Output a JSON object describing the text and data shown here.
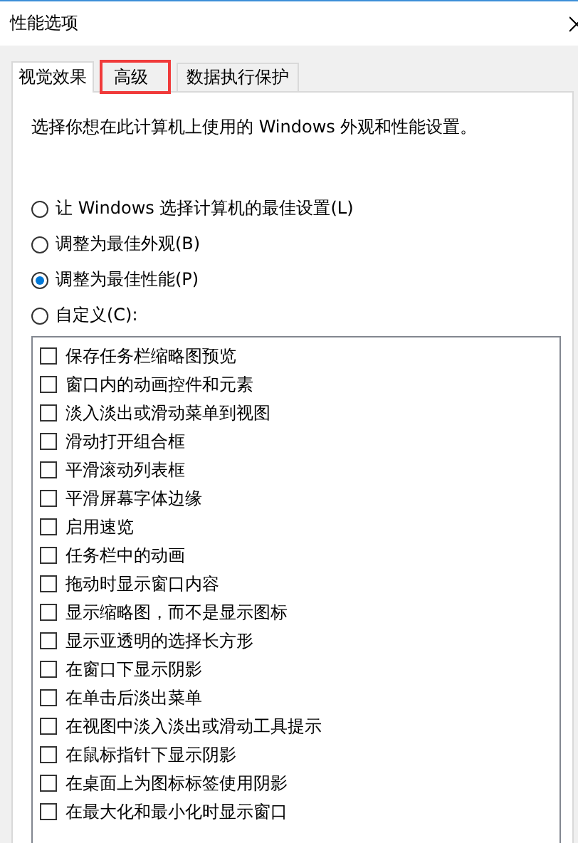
{
  "window": {
    "title": "性能选项"
  },
  "tabs": [
    {
      "label": "视觉效果",
      "selected": true,
      "highlighted": false
    },
    {
      "label": "高级",
      "selected": false,
      "highlighted": true
    },
    {
      "label": "数据执行保护",
      "selected": false,
      "highlighted": false
    }
  ],
  "description": "选择你想在此计算机上使用的 Windows 外观和性能设置。",
  "options": [
    {
      "label": "让 Windows 选择计算机的最佳设置(L)",
      "selected": false
    },
    {
      "label": "调整为最佳外观(B)",
      "selected": false
    },
    {
      "label": "调整为最佳性能(P)",
      "selected": true
    },
    {
      "label": "自定义(C):",
      "selected": false
    }
  ],
  "effects": [
    {
      "label": "保存任务栏缩略图预览",
      "checked": false
    },
    {
      "label": "窗口内的动画控件和元素",
      "checked": false
    },
    {
      "label": "淡入淡出或滑动菜单到视图",
      "checked": false
    },
    {
      "label": "滑动打开组合框",
      "checked": false
    },
    {
      "label": "平滑滚动列表框",
      "checked": false
    },
    {
      "label": "平滑屏幕字体边缘",
      "checked": false
    },
    {
      "label": "启用速览",
      "checked": false
    },
    {
      "label": "任务栏中的动画",
      "checked": false
    },
    {
      "label": "拖动时显示窗口内容",
      "checked": false
    },
    {
      "label": "显示缩略图，而不是显示图标",
      "checked": false
    },
    {
      "label": "显示亚透明的选择长方形",
      "checked": false
    },
    {
      "label": "在窗口下显示阴影",
      "checked": false
    },
    {
      "label": "在单击后淡出菜单",
      "checked": false
    },
    {
      "label": "在视图中淡入淡出或滑动工具提示",
      "checked": false
    },
    {
      "label": "在鼠标指针下显示阴影",
      "checked": false
    },
    {
      "label": "在桌面上为图标标签使用阴影",
      "checked": false
    },
    {
      "label": "在最大化和最小化时显示窗口",
      "checked": false
    }
  ]
}
